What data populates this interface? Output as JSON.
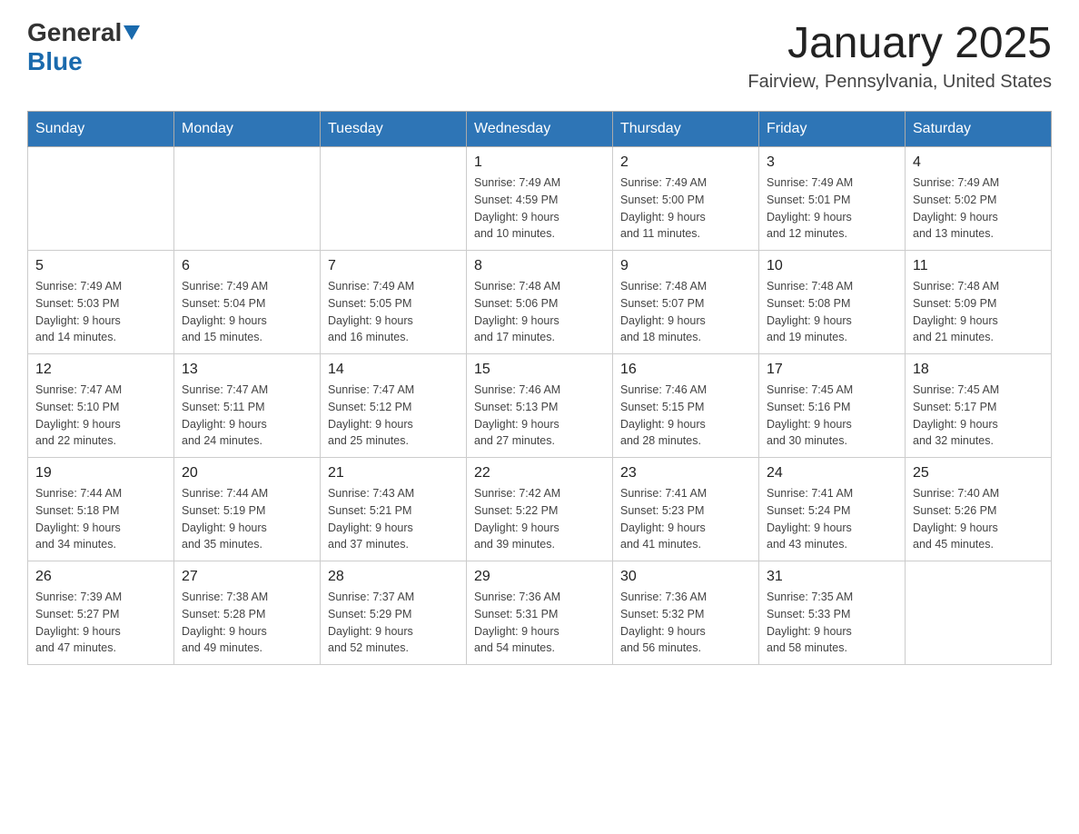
{
  "header": {
    "logo": {
      "general": "General",
      "blue": "Blue",
      "arrow": "▼"
    },
    "title": "January 2025",
    "subtitle": "Fairview, Pennsylvania, United States"
  },
  "days_of_week": [
    "Sunday",
    "Monday",
    "Tuesday",
    "Wednesday",
    "Thursday",
    "Friday",
    "Saturday"
  ],
  "weeks": [
    {
      "days": [
        {
          "number": "",
          "info": ""
        },
        {
          "number": "",
          "info": ""
        },
        {
          "number": "",
          "info": ""
        },
        {
          "number": "1",
          "info": "Sunrise: 7:49 AM\nSunset: 4:59 PM\nDaylight: 9 hours\nand 10 minutes."
        },
        {
          "number": "2",
          "info": "Sunrise: 7:49 AM\nSunset: 5:00 PM\nDaylight: 9 hours\nand 11 minutes."
        },
        {
          "number": "3",
          "info": "Sunrise: 7:49 AM\nSunset: 5:01 PM\nDaylight: 9 hours\nand 12 minutes."
        },
        {
          "number": "4",
          "info": "Sunrise: 7:49 AM\nSunset: 5:02 PM\nDaylight: 9 hours\nand 13 minutes."
        }
      ]
    },
    {
      "days": [
        {
          "number": "5",
          "info": "Sunrise: 7:49 AM\nSunset: 5:03 PM\nDaylight: 9 hours\nand 14 minutes."
        },
        {
          "number": "6",
          "info": "Sunrise: 7:49 AM\nSunset: 5:04 PM\nDaylight: 9 hours\nand 15 minutes."
        },
        {
          "number": "7",
          "info": "Sunrise: 7:49 AM\nSunset: 5:05 PM\nDaylight: 9 hours\nand 16 minutes."
        },
        {
          "number": "8",
          "info": "Sunrise: 7:48 AM\nSunset: 5:06 PM\nDaylight: 9 hours\nand 17 minutes."
        },
        {
          "number": "9",
          "info": "Sunrise: 7:48 AM\nSunset: 5:07 PM\nDaylight: 9 hours\nand 18 minutes."
        },
        {
          "number": "10",
          "info": "Sunrise: 7:48 AM\nSunset: 5:08 PM\nDaylight: 9 hours\nand 19 minutes."
        },
        {
          "number": "11",
          "info": "Sunrise: 7:48 AM\nSunset: 5:09 PM\nDaylight: 9 hours\nand 21 minutes."
        }
      ]
    },
    {
      "days": [
        {
          "number": "12",
          "info": "Sunrise: 7:47 AM\nSunset: 5:10 PM\nDaylight: 9 hours\nand 22 minutes."
        },
        {
          "number": "13",
          "info": "Sunrise: 7:47 AM\nSunset: 5:11 PM\nDaylight: 9 hours\nand 24 minutes."
        },
        {
          "number": "14",
          "info": "Sunrise: 7:47 AM\nSunset: 5:12 PM\nDaylight: 9 hours\nand 25 minutes."
        },
        {
          "number": "15",
          "info": "Sunrise: 7:46 AM\nSunset: 5:13 PM\nDaylight: 9 hours\nand 27 minutes."
        },
        {
          "number": "16",
          "info": "Sunrise: 7:46 AM\nSunset: 5:15 PM\nDaylight: 9 hours\nand 28 minutes."
        },
        {
          "number": "17",
          "info": "Sunrise: 7:45 AM\nSunset: 5:16 PM\nDaylight: 9 hours\nand 30 minutes."
        },
        {
          "number": "18",
          "info": "Sunrise: 7:45 AM\nSunset: 5:17 PM\nDaylight: 9 hours\nand 32 minutes."
        }
      ]
    },
    {
      "days": [
        {
          "number": "19",
          "info": "Sunrise: 7:44 AM\nSunset: 5:18 PM\nDaylight: 9 hours\nand 34 minutes."
        },
        {
          "number": "20",
          "info": "Sunrise: 7:44 AM\nSunset: 5:19 PM\nDaylight: 9 hours\nand 35 minutes."
        },
        {
          "number": "21",
          "info": "Sunrise: 7:43 AM\nSunset: 5:21 PM\nDaylight: 9 hours\nand 37 minutes."
        },
        {
          "number": "22",
          "info": "Sunrise: 7:42 AM\nSunset: 5:22 PM\nDaylight: 9 hours\nand 39 minutes."
        },
        {
          "number": "23",
          "info": "Sunrise: 7:41 AM\nSunset: 5:23 PM\nDaylight: 9 hours\nand 41 minutes."
        },
        {
          "number": "24",
          "info": "Sunrise: 7:41 AM\nSunset: 5:24 PM\nDaylight: 9 hours\nand 43 minutes."
        },
        {
          "number": "25",
          "info": "Sunrise: 7:40 AM\nSunset: 5:26 PM\nDaylight: 9 hours\nand 45 minutes."
        }
      ]
    },
    {
      "days": [
        {
          "number": "26",
          "info": "Sunrise: 7:39 AM\nSunset: 5:27 PM\nDaylight: 9 hours\nand 47 minutes."
        },
        {
          "number": "27",
          "info": "Sunrise: 7:38 AM\nSunset: 5:28 PM\nDaylight: 9 hours\nand 49 minutes."
        },
        {
          "number": "28",
          "info": "Sunrise: 7:37 AM\nSunset: 5:29 PM\nDaylight: 9 hours\nand 52 minutes."
        },
        {
          "number": "29",
          "info": "Sunrise: 7:36 AM\nSunset: 5:31 PM\nDaylight: 9 hours\nand 54 minutes."
        },
        {
          "number": "30",
          "info": "Sunrise: 7:36 AM\nSunset: 5:32 PM\nDaylight: 9 hours\nand 56 minutes."
        },
        {
          "number": "31",
          "info": "Sunrise: 7:35 AM\nSunset: 5:33 PM\nDaylight: 9 hours\nand 58 minutes."
        },
        {
          "number": "",
          "info": ""
        }
      ]
    }
  ]
}
